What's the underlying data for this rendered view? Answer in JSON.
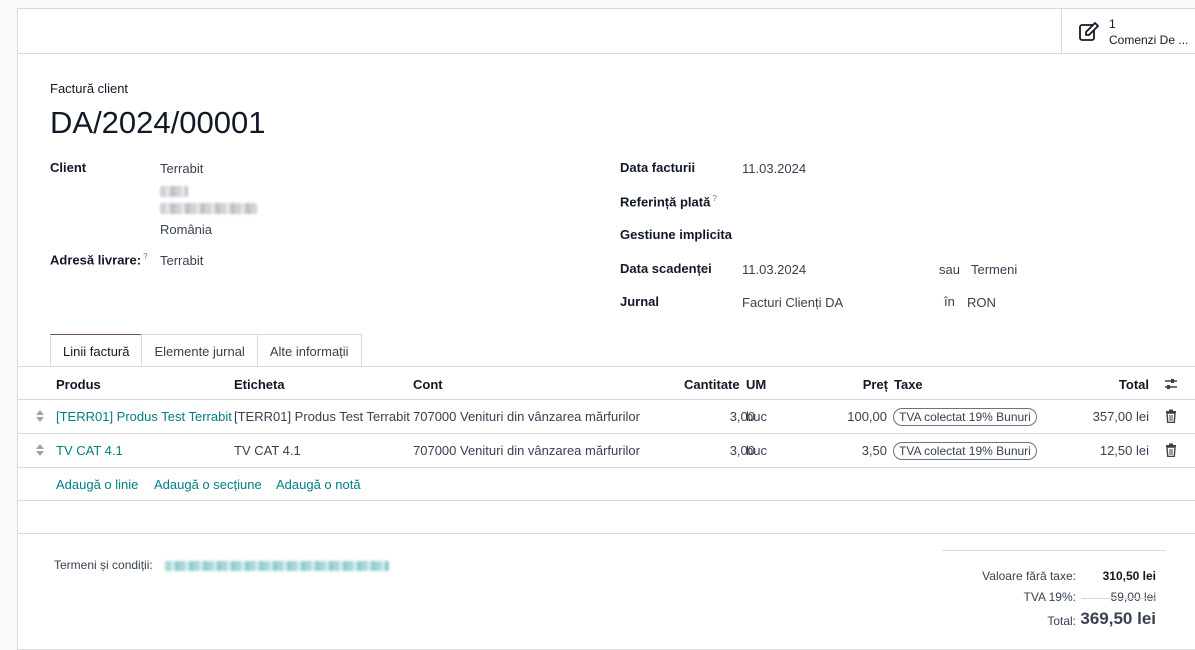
{
  "smart_button": {
    "count": "1",
    "label": "Comenzi De ..."
  },
  "header": {
    "doc_type": "Factură client",
    "name": "DA/2024/00001"
  },
  "left_fields": {
    "client_label": "Client",
    "client_name": "Terrabit",
    "client_country": "România",
    "delivery_label": "Adresă livrare:",
    "delivery_help": "?",
    "delivery_value": "Terrabit"
  },
  "right_fields": {
    "invoice_date_label": "Data facturii",
    "invoice_date": "11.03.2024",
    "payment_ref_label": "Referință plată",
    "payment_ref_help": "?",
    "stock_label": "Gestiune implicita",
    "due_date_label": "Data scadenței",
    "due_date": "11.03.2024",
    "or_label": "sau",
    "terms_value": "Termeni",
    "journal_label": "Jurnal",
    "journal_value": "Facturi Clienți DA",
    "in_label": "în",
    "currency": "RON"
  },
  "tabs": [
    "Linii factură",
    "Elemente jurnal",
    "Alte informații"
  ],
  "table": {
    "headers": {
      "product": "Produs",
      "label": "Eticheta",
      "account": "Cont",
      "quantity": "Cantitate",
      "uom": "UM",
      "price": "Preț",
      "taxes": "Taxe",
      "total": "Total"
    },
    "rows": [
      {
        "product": "[TERR01] Produs Test Terrabit",
        "label": "[TERR01] Produs Test Terrabit",
        "account": "707000 Venituri din vânzarea mărfurilor",
        "quantity": "3,00",
        "uom": "buc",
        "price": "100,00",
        "tax": "TVA colectat 19% Bunuri",
        "total": "357,00 lei"
      },
      {
        "product": "TV CAT 4.1",
        "label": "TV CAT 4.1",
        "account": "707000 Venituri din vânzarea mărfurilor",
        "quantity": "3,00",
        "uom": "buc",
        "price": "3,50",
        "tax": "TVA colectat 19% Bunuri",
        "total": "12,50 lei"
      }
    ],
    "add_line": "Adaugă o linie",
    "add_section": "Adaugă o secțiune",
    "add_note": "Adaugă o notă"
  },
  "footer": {
    "terms_label": "Termeni și condiții:",
    "untaxed_label": "Valoare fără taxe:",
    "untaxed_value": "310,50 lei",
    "vat_label": "TVA 19%:",
    "vat_value": "59,00 lei",
    "total_label": "Total:",
    "total_value": "369,50 lei"
  },
  "colors": {
    "accent": "#714b67",
    "link": "#017e84",
    "border": "#d8dadd"
  }
}
